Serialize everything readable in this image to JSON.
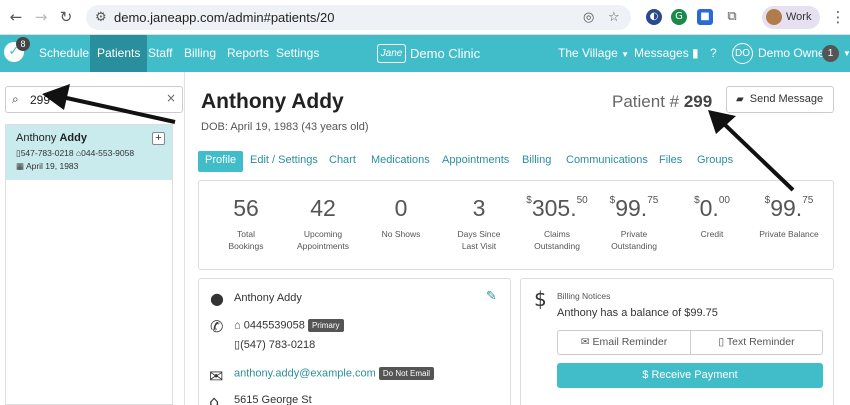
{
  "browser": {
    "url": "demo.janeapp.com/admin#patients/20",
    "profile": "Work"
  },
  "appbar": {
    "badge": "8",
    "nav": [
      "Schedule",
      "Patients",
      "Staff",
      "Billing",
      "Reports",
      "Settings"
    ],
    "brand_logo": "Jane",
    "brand": "Demo Clinic",
    "location": "The Village",
    "messages": "Messages",
    "help": "?",
    "user_initials": "DO",
    "user": "Demo Owner",
    "user_count": "1"
  },
  "search": {
    "value": "299"
  },
  "patient_card": {
    "first": "Anthony",
    "last": "Addy",
    "mobile": "547-783-0218",
    "home": "044-553-9058",
    "dob": "April 19, 1983"
  },
  "patient": {
    "name": "Anthony Addy",
    "dob": "DOB: April 19, 1983 (43 years old)",
    "number_label": "Patient #",
    "number": "299",
    "send_message": "Send Message"
  },
  "tabs": [
    "Profile",
    "Edit / Settings",
    "Chart",
    "Medications",
    "Appointments",
    "Billing",
    "Communications",
    "Files",
    "Groups"
  ],
  "stats": [
    {
      "cur": "",
      "val": "56",
      "cents": "",
      "label1": "Total",
      "label2": "Bookings"
    },
    {
      "cur": "",
      "val": "42",
      "cents": "",
      "label1": "Upcoming",
      "label2": "Appointments"
    },
    {
      "cur": "",
      "val": "0",
      "cents": "",
      "label1": "No Shows",
      "label2": ""
    },
    {
      "cur": "",
      "val": "3",
      "cents": "",
      "label1": "Days Since",
      "label2": "Last Visit"
    },
    {
      "cur": "$",
      "val": "305.",
      "cents": "50",
      "label1": "Claims",
      "label2": "Outstanding"
    },
    {
      "cur": "$",
      "val": "99.",
      "cents": "75",
      "label1": "Private",
      "label2": "Outstanding"
    },
    {
      "cur": "$",
      "val": "0.",
      "cents": "00",
      "label1": "Credit",
      "label2": ""
    },
    {
      "cur": "$",
      "val": "99.",
      "cents": "75",
      "label1": "Private Balance",
      "label2": ""
    }
  ],
  "contact": {
    "name": "Anthony Addy",
    "home_phone": "0445539058",
    "primary": "Primary",
    "mobile": "(547) 783-0218",
    "email": "anthony.addy@example.com",
    "do_not_email": "Do Not Email",
    "address": "5615 George St"
  },
  "billing": {
    "title": "Billing Notices",
    "notice": "Anthony has a balance of $99.75",
    "email_reminder": "Email Reminder",
    "text_reminder": "Text Reminder",
    "receive_payment": "Receive Payment"
  },
  "colors": {
    "accent": "#41bdc9",
    "accent_dark": "#2a8f9c"
  }
}
